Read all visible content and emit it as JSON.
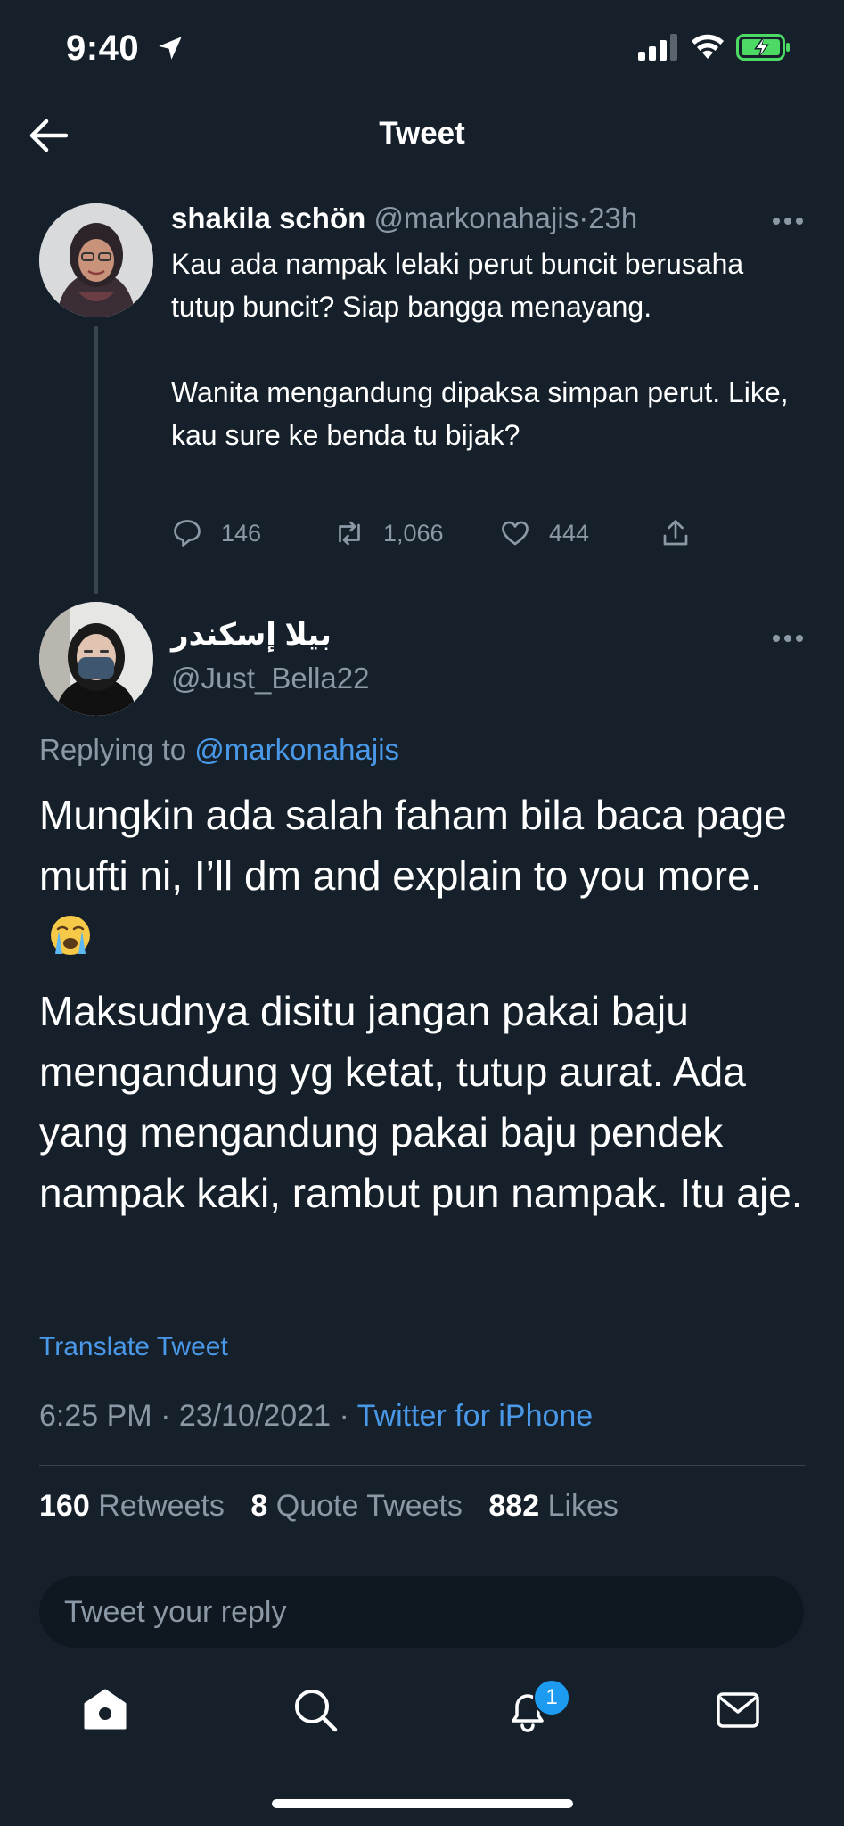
{
  "status_bar": {
    "time": "9:40"
  },
  "header": {
    "title": "Tweet"
  },
  "parent_tweet": {
    "display_name": "shakila schön",
    "handle": "@markonahajis",
    "separator": "·",
    "time_ago": "23h",
    "body": "Kau ada nampak lelaki perut buncit berusaha tutup buncit? Siap bangga menayang.\n\nWanita mengandung dipaksa simpan perut. Like, kau sure ke benda tu bijak?",
    "replies": "146",
    "retweets": "1,066",
    "likes": "444"
  },
  "main_tweet": {
    "display_name": "بيلا إسكندر",
    "handle": "@Just_Bella22",
    "replying_prefix": "Replying to",
    "replying_to": "@markonahajis",
    "paragraph_1": "Mungkin ada salah faham bila baca page mufti ni, I’ll dm and explain to you more.",
    "paragraph_2": "Maksudnya disitu jangan pakai baju mengandung yg ketat, tutup aurat. Ada yang mengandung pakai baju pendek nampak kaki, rambut pun nampak. Itu aje.",
    "translate_label": "Translate Tweet",
    "time": "6:25 PM",
    "date": "23/10/2021",
    "sep": "·",
    "source": "Twitter for iPhone",
    "retweets_count": "160",
    "retweets_label": "Retweets",
    "quote_count": "8",
    "quote_label": "Quote Tweets",
    "likes_count": "882",
    "likes_label": "Likes"
  },
  "reply_bar": {
    "placeholder": "Tweet your reply"
  },
  "bottom_nav": {
    "notifications_badge": "1"
  },
  "colors": {
    "background": "#15202b",
    "accent": "#1d9bf0",
    "link": "#4a99e9",
    "muted": "#8b98a5",
    "divider": "#38444d"
  }
}
